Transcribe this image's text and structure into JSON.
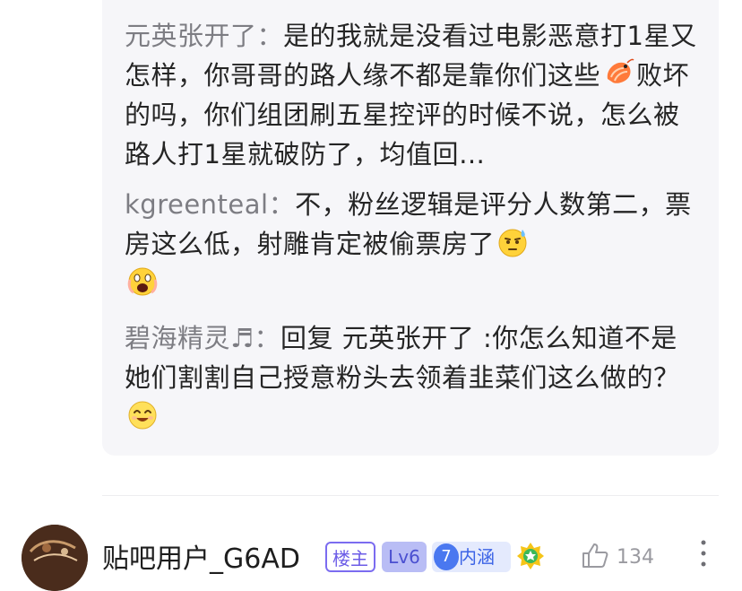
{
  "replies": [
    {
      "username": "元英张开了",
      "sep": "：",
      "text_a": "是的我就是没看过电影恶意打1星又怎样，你哥哥的路人缘不都是靠你们这些",
      "emoji": "shrimp-emoji",
      "text_b": "败坏的吗，你们组团刷五星控评的时候不说，怎么被路人打1星就破防了，均值回…"
    },
    {
      "username": "kgreenteal",
      "sep": "：",
      "text_a": "不，粉丝逻辑是评分人数第二，票房这么低，射雕肯定被偷票房了",
      "emoji_1": "sweat-emoji",
      "emoji_2": "scream-emoji"
    },
    {
      "username": "碧海精灵♬",
      "sep": "：",
      "text_a": "回复 元英张开了 :你怎么知道不是她们割割自己授意粉头去领着韭菜们这么做的？",
      "emoji": "laugh-emoji"
    }
  ],
  "comment": {
    "author": "贴吧用户_G6AD",
    "badge_owner": "楼主",
    "badge_level": "Lv6",
    "badge_neihan_num": "7",
    "badge_neihan": "内涵",
    "medal_icon": "star-medal-icon",
    "like_icon": "thumbs-up-icon",
    "like_count": "134",
    "more_icon": "more-vertical-icon"
  },
  "colors": {
    "reply_bg": "#f6f6f9",
    "username": "#7d7d83",
    "badge_owner": "#6c5ce7",
    "badge_neihan": "#3b63e6"
  }
}
